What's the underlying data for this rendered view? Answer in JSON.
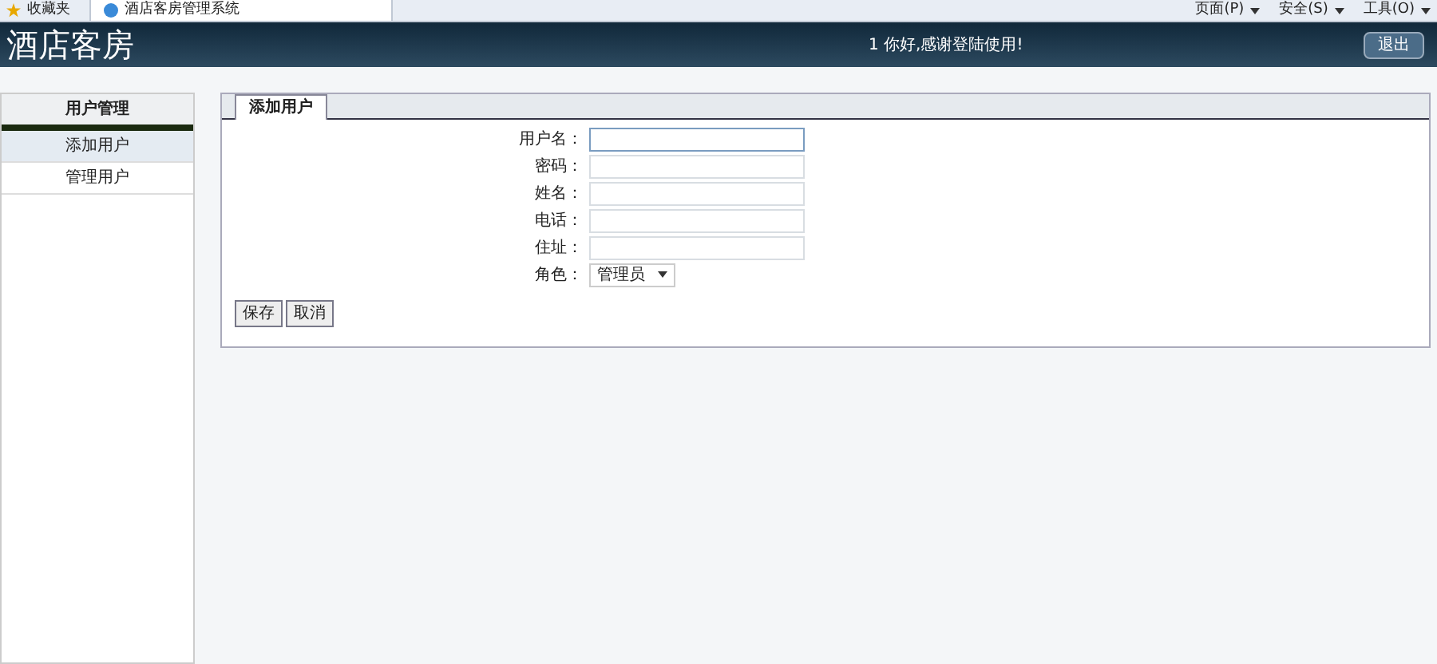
{
  "browser": {
    "favorites": "收藏夹",
    "tab": "酒店客房管理系统",
    "menus": [
      "页面(P)",
      "安全(S)",
      "工具(O)"
    ]
  },
  "header": {
    "title": "酒店客房",
    "greeting": "1 你好,感谢登陆使用!",
    "logout": "退出"
  },
  "sidebar": {
    "heading": "用户管理",
    "items": [
      {
        "label": "添加用户",
        "selected": true
      },
      {
        "label": "管理用户",
        "selected": false
      }
    ]
  },
  "panel": {
    "tab": "添加用户",
    "fields": [
      {
        "kind": "text",
        "label": "用户名：",
        "focused": true
      },
      {
        "kind": "text",
        "label": "密码：",
        "focused": false
      },
      {
        "kind": "text",
        "label": "姓名：",
        "focused": false
      },
      {
        "kind": "text",
        "label": "电话：",
        "focused": false
      },
      {
        "kind": "text",
        "label": "住址：",
        "focused": false
      },
      {
        "kind": "select",
        "label": "角色：",
        "value": "管理员"
      }
    ],
    "buttons": [
      "保存",
      "取消"
    ]
  }
}
